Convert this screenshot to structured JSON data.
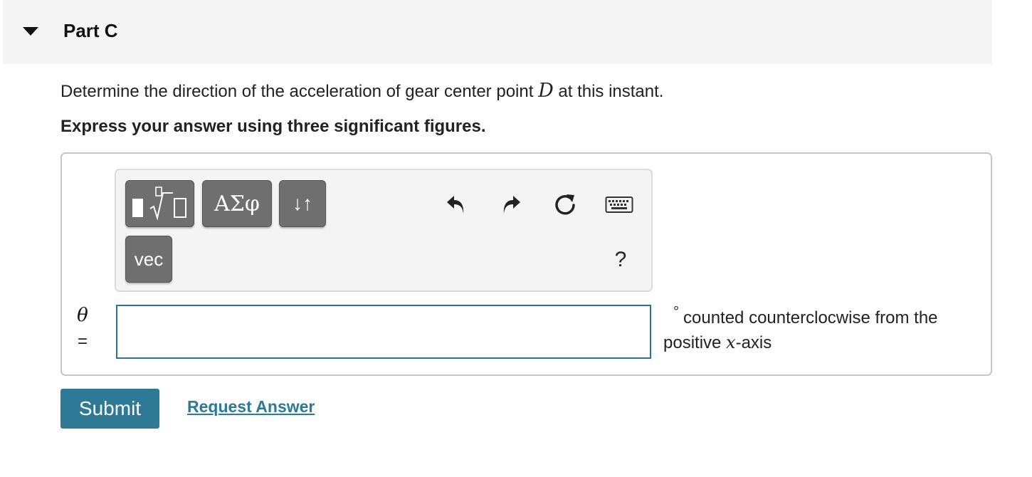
{
  "part": {
    "title": "Part C"
  },
  "question": {
    "text_before": "Determine the direction of the acceleration of gear center point ",
    "math_var": "D",
    "text_after": " at this instant."
  },
  "instruction": "Express your answer using three significant figures.",
  "toolbar": {
    "symbols_label": "ΑΣφ",
    "arrows_label": "↓↑",
    "vec_label": "vec",
    "help_label": "?",
    "icons": [
      "templates-icon",
      "undo-icon",
      "redo-icon",
      "reset-icon",
      "keyboard-icon"
    ]
  },
  "answer": {
    "variable": "θ",
    "equals": "=",
    "value": "",
    "unit_symbol": "°",
    "unit_text_1": "counted counterclocwise from the positive ",
    "unit_math": "x",
    "unit_text_2": "-axis"
  },
  "actions": {
    "submit_label": "Submit",
    "request_label": "Request Answer"
  },
  "colors": {
    "accent": "#2d7996",
    "toolbar_button": "#6f6f6f",
    "header_bg": "#f5f5f5"
  }
}
